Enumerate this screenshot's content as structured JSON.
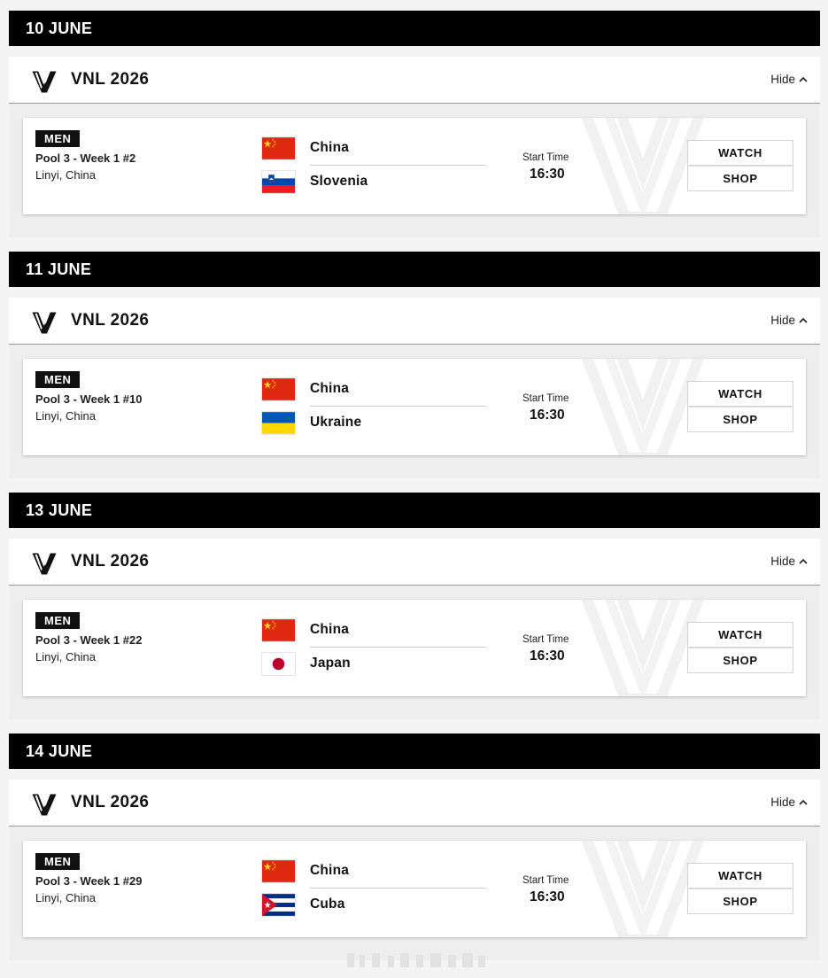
{
  "days": [
    {
      "date": "10 JUNE",
      "league": "VNL 2026",
      "hide_label": "Hide",
      "match": {
        "gender": "MEN",
        "info": "Pool 3 - Week 1 #2",
        "venue": "Linyi, China",
        "home": {
          "name": "China",
          "flag": "china-flag"
        },
        "away": {
          "name": "Slovenia",
          "flag": "slovenia-flag"
        },
        "start_label": "Start Time",
        "start_time": "16:30",
        "watch_label": "WATCH",
        "shop_label": "SHOP"
      }
    },
    {
      "date": "11 JUNE",
      "league": "VNL 2026",
      "hide_label": "Hide",
      "match": {
        "gender": "MEN",
        "info": "Pool 3 - Week 1 #10",
        "venue": "Linyi, China",
        "home": {
          "name": "China",
          "flag": "china-flag"
        },
        "away": {
          "name": "Ukraine",
          "flag": "ukraine-flag"
        },
        "start_label": "Start Time",
        "start_time": "16:30",
        "watch_label": "WATCH",
        "shop_label": "SHOP"
      }
    },
    {
      "date": "13 JUNE",
      "league": "VNL 2026",
      "hide_label": "Hide",
      "match": {
        "gender": "MEN",
        "info": "Pool 3 - Week 1 #22",
        "venue": "Linyi, China",
        "home": {
          "name": "China",
          "flag": "china-flag"
        },
        "away": {
          "name": "Japan",
          "flag": "japan-flag"
        },
        "start_label": "Start Time",
        "start_time": "16:30",
        "watch_label": "WATCH",
        "shop_label": "SHOP"
      }
    },
    {
      "date": "14 JUNE",
      "league": "VNL 2026",
      "hide_label": "Hide",
      "match": {
        "gender": "MEN",
        "info": "Pool 3 - Week 1 #29",
        "venue": "Linyi, China",
        "home": {
          "name": "China",
          "flag": "china-flag"
        },
        "away": {
          "name": "Cuba",
          "flag": "cuba-flag"
        },
        "start_label": "Start Time",
        "start_time": "16:30",
        "watch_label": "WATCH",
        "shop_label": "SHOP"
      }
    }
  ],
  "colors": {
    "date_bar": "#000000",
    "card_bg": "#ffffff",
    "group_bg": "#eeeeee",
    "china_red": "#de2910",
    "china_yellow": "#ffde00"
  }
}
